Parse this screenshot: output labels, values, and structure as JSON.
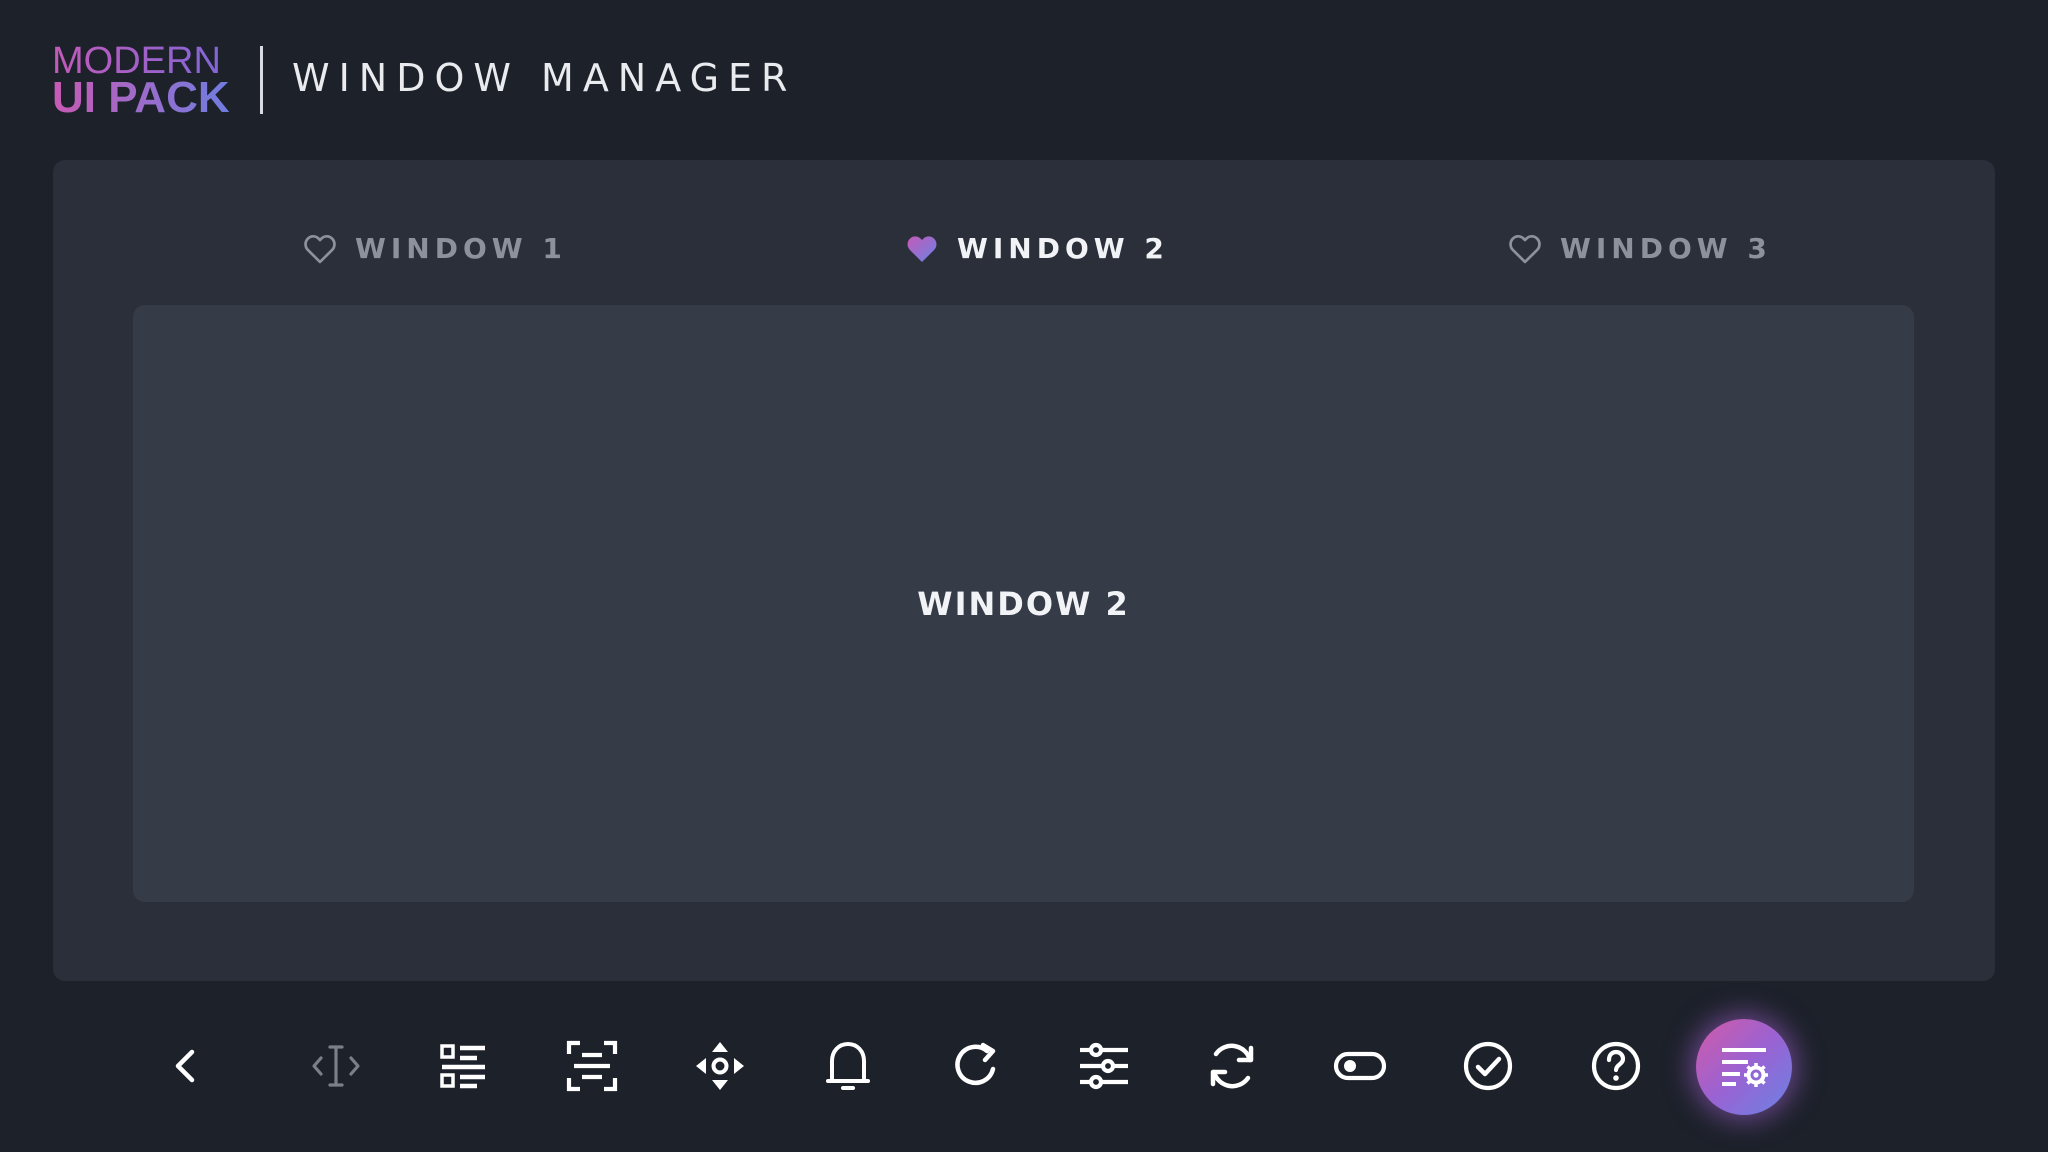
{
  "logo": {
    "top_text": "MODERN",
    "bottom_text": "UI PACK"
  },
  "header": {
    "title": "WINDOW MANAGER"
  },
  "tabs": [
    {
      "label": "WINDOW 1",
      "active": false,
      "icon": "heart-outline-icon"
    },
    {
      "label": "WINDOW 2",
      "active": true,
      "icon": "heart-filled-icon"
    },
    {
      "label": "WINDOW 3",
      "active": false,
      "icon": "heart-outline-icon"
    }
  ],
  "content": {
    "title": "WINDOW 2"
  },
  "toolbar": {
    "items": [
      {
        "icon": "chevron-left-icon"
      },
      {
        "icon": "text-cursor-icon"
      },
      {
        "icon": "list-icon"
      },
      {
        "icon": "scan-icon"
      },
      {
        "icon": "move-icon"
      },
      {
        "icon": "bell-icon"
      },
      {
        "icon": "refresh-icon"
      },
      {
        "icon": "sliders-icon"
      },
      {
        "icon": "sync-icon"
      },
      {
        "icon": "toggle-icon"
      },
      {
        "icon": "check-circle-icon"
      },
      {
        "icon": "help-circle-icon"
      },
      {
        "icon": "settings-list-icon"
      }
    ]
  },
  "colors": {
    "background": "#1c212a",
    "card": "#2a2f3a",
    "content_panel": "#363c47",
    "accent_start": "#d25aa8",
    "accent_end": "#6b82e4",
    "text_active": "#f2f3f6",
    "text_inactive": "#8c919b"
  }
}
